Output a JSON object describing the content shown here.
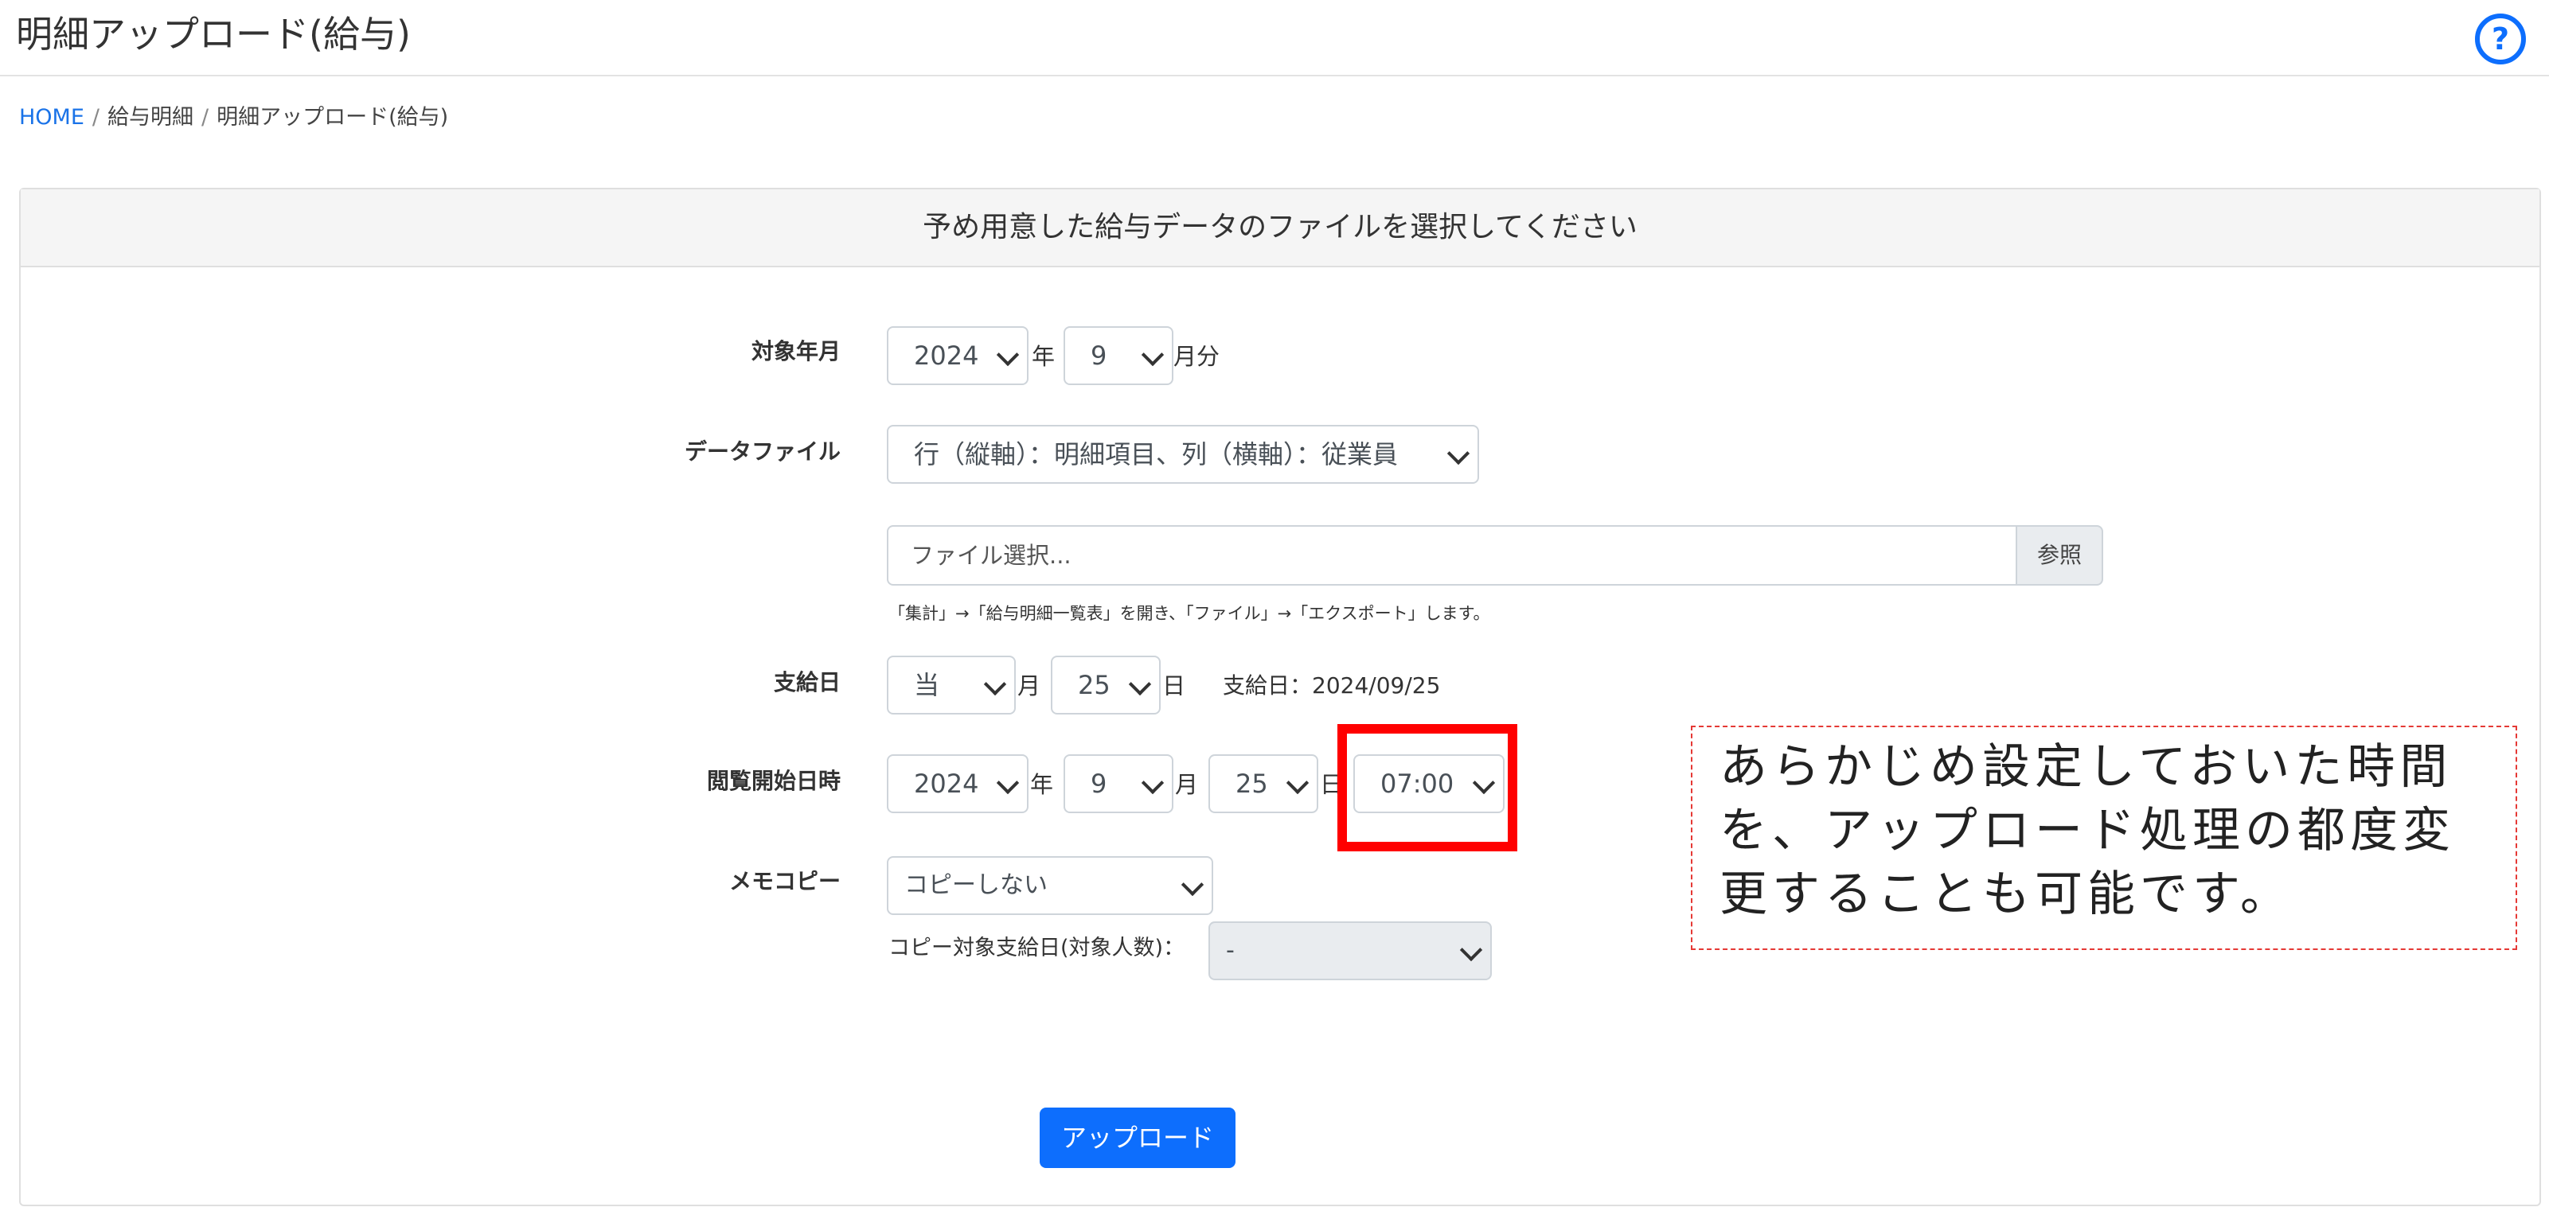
{
  "header": {
    "title": "明細アップロード(給与)",
    "help_icon": "question-circle-icon"
  },
  "breadcrumb": {
    "home": "HOME",
    "level1": "給与明細",
    "current": "明細アップロード(給与)",
    "separator": "/"
  },
  "card": {
    "title": "予め用意した給与データのファイルを選択してください"
  },
  "form": {
    "target_month": {
      "label": "対象年月",
      "year": "2024",
      "year_unit": "年",
      "month": "9",
      "month_unit": "月分"
    },
    "data_file": {
      "label": "データファイル",
      "format_selected": "行（縦軸）：明細項目、列（横軸）：従業員",
      "file_placeholder": "ファイル選択...",
      "browse_label": "参照",
      "hint": "「集計」→「給与明細一覧表」を開き、「ファイル」→「エクスポート」します。"
    },
    "payday": {
      "label": "支給日",
      "month": "当",
      "month_unit": "月",
      "day": "25",
      "day_unit": "日",
      "info": "支給日：2024/09/25"
    },
    "view_start": {
      "label": "閲覧開始日時",
      "year": "2024",
      "year_unit": "年",
      "month": "9",
      "month_unit": "月",
      "day": "25",
      "day_unit": "日",
      "time": "07:00"
    },
    "memo_copy": {
      "label": "メモコピー",
      "selected": "コピーしない",
      "target_label": "コピー対象支給日(対象人数)：",
      "target_selected": "-"
    },
    "upload_button": "アップロード"
  },
  "callout": {
    "line1": "あらかじめ設定しておいた時間",
    "line2": "を、アップロード処理の都度変",
    "line3": "更することも可能です。"
  },
  "colors": {
    "primary": "#0d6efd",
    "link": "#1a73e8",
    "highlight": "#ff0000",
    "callout_border": "#e53935"
  }
}
